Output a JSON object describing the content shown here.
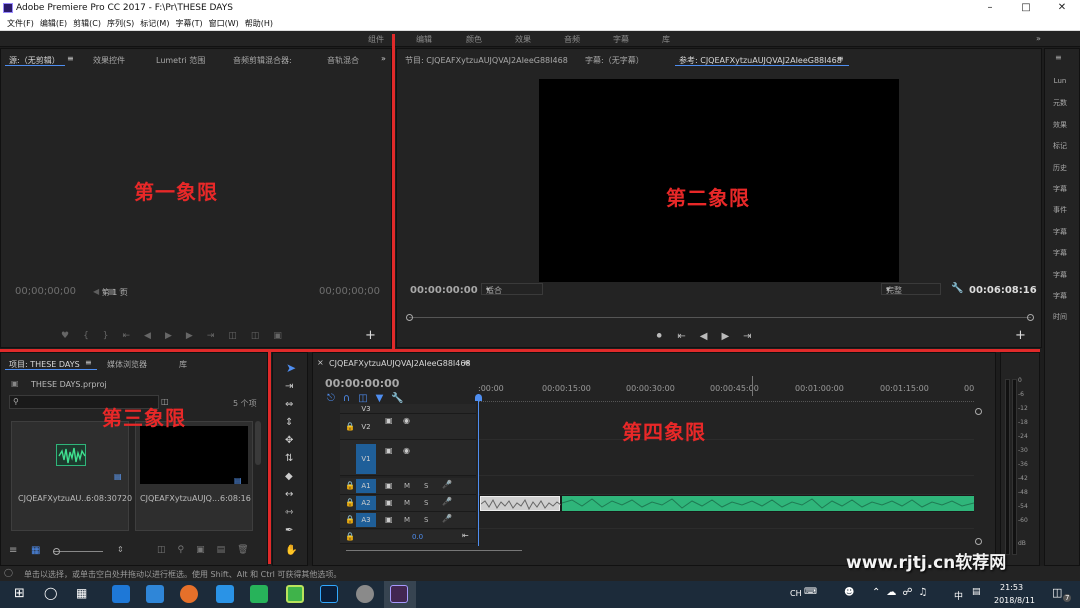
{
  "window": {
    "title": "Adobe Premiere Pro CC 2017 - F:\\Pr\\THESE DAYS"
  },
  "menu": [
    "文件(F)",
    "编辑(E)",
    "剪辑(C)",
    "序列(S)",
    "标记(M)",
    "字幕(T)",
    "窗口(W)",
    "帮助(H)"
  ],
  "workspaces": [
    "组件",
    "编辑",
    "颜色",
    "效果",
    "音频",
    "字幕",
    "库"
  ],
  "source_panel": {
    "tabs": [
      "源:（无剪辑）",
      "效果控件",
      "Lumetri 范围",
      "音频剪辑混合器:",
      "音轨混合"
    ],
    "timecode_left": "00;00;00;00",
    "page_select": "第 1 页",
    "timecode_right": "00;00;00;00"
  },
  "program_panel": {
    "tabs": [
      "节目: CJQEAFXytzuAUJQVAJ2AIeeG88I468",
      "字幕:（无字幕）",
      "参考: CJQEAFXytzuAUJQVAJ2AIeeG88I468"
    ],
    "timecode": "00:00:00:00",
    "fit": "适合",
    "quality": "完整",
    "duration": "00:06:08:16"
  },
  "project_panel": {
    "tabs": [
      "项目: THESE DAYS",
      "媒体浏览器",
      "库"
    ],
    "project_file": "THESE DAYS.prproj",
    "item_count": "5 个项",
    "items": [
      {
        "name": "CJQEAFXytzuAU...",
        "duration": "6:08:30720"
      },
      {
        "name": "CJQEAFXytzuAUJQ...",
        "duration": "6:08:16"
      }
    ]
  },
  "timeline": {
    "sequence_tab": "CJQEAFXytzuAUJQVAJ2AIeeG88I468",
    "timecode": "00:00:00:00",
    "ruler": [
      ":00:00",
      "00:00:15:00",
      "00:00:30:00",
      "00:00:45:00",
      "00:01:00:00",
      "00:01:15:00",
      "00"
    ],
    "tracks": [
      {
        "label": "V3"
      },
      {
        "label": "V2"
      },
      {
        "label": "V1"
      },
      {
        "label": "A1"
      },
      {
        "label": "A2"
      },
      {
        "label": "A3"
      }
    ],
    "track_buttons": {
      "mute": "M",
      "solo": "S"
    },
    "master_value": "0.0"
  },
  "right_panel": [
    "Lun",
    "元数",
    "效果",
    "标记",
    "历史",
    "字幕",
    "事件",
    "字幕",
    "字幕",
    "字幕",
    "字幕",
    "时间"
  ],
  "audio_meter": [
    "0",
    "-6",
    "-12",
    "-18",
    "-24",
    "-30",
    "-36",
    "-42",
    "-48",
    "-54",
    "-60",
    "dB"
  ],
  "annotations": {
    "q1": "第一象限",
    "q2": "第二象限",
    "q3": "第三象限",
    "q4": "第四象限"
  },
  "status_bar": "单击以选择，或单击空白处并拖动以进行框选。使用 Shift、Alt 和 Ctrl 可获得其他选项。",
  "watermark": "www.rjtj.cn软荐网",
  "taskbar": {
    "ime": "CH",
    "lang": "中",
    "time": "21:53",
    "date": "2018/8/11",
    "notifications": "7"
  },
  "colors": {
    "accent_blue": "#4f8ef0",
    "audio_clip": "#2fb57a",
    "annotation_red": "#e02a2a",
    "track_select": "#1f5f99"
  }
}
